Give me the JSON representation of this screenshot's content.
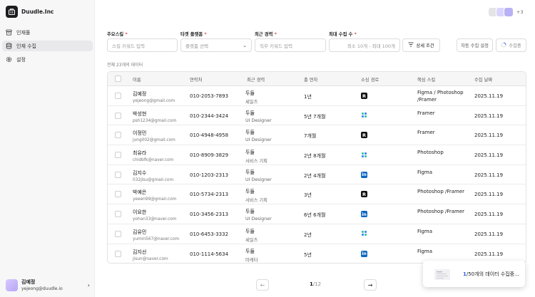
{
  "app": {
    "name": "Duudle.Inc"
  },
  "sidebar": {
    "items": [
      {
        "label": "인재풀",
        "icon": "archive-icon",
        "active": false
      },
      {
        "label": "인재 수집",
        "icon": "database-icon",
        "active": true
      },
      {
        "label": "설정",
        "icon": "gear-icon",
        "active": false
      }
    ]
  },
  "user": {
    "name": "김예정",
    "email": "yejeong@duudle.io"
  },
  "collaborators": {
    "more": "+3",
    "colors": [
      "#e4e4e8",
      "#d8d4fb",
      "#b9b1f5"
    ]
  },
  "filters": {
    "main_skill": {
      "label": "주요스킬",
      "placeholder": "스킬 키워드 입력"
    },
    "target_platform": {
      "label": "타겟 플랫폼",
      "placeholder": "플랫폼 선택"
    },
    "recent_career": {
      "label": "최근 경력",
      "placeholder": "직무 키워드 입력"
    },
    "max_collect": {
      "label": "최대 수집 수",
      "placeholder": "최소 10개 - 최대 100개"
    },
    "detail_button": "상세 조건",
    "auto_setting_button": "자동 수집 설정",
    "collecting_button": "수집중"
  },
  "result_count": "전체 23개의 데이터",
  "table": {
    "headers": [
      "이름",
      "연락처",
      "최근 경력",
      "총 연차",
      "소싱 경로",
      "핵심 스킬",
      "수집 날짜"
    ],
    "rows": [
      {
        "name": "김예정",
        "email": "yejeong@gmail.com",
        "phone": "010-2053-7893",
        "career_company": "두들",
        "career_role": "세일즈",
        "years": "1년",
        "source": "remember",
        "skills": "Figma / Photoshop /Framer",
        "date": "2025.11.19"
      },
      {
        "name": "박성현",
        "email": "psh1234@gmail.com",
        "phone": "010-2344-3424",
        "career_company": "두들",
        "career_role": "UI Designer",
        "years": "5년 7개월",
        "source": "dots",
        "skills": "Framer",
        "date": "2025.11.19"
      },
      {
        "name": "이정민",
        "email": "jung002@gmail.com",
        "phone": "010-4948-4958",
        "career_company": "두들",
        "career_role": "UI Designer",
        "years": "7개월",
        "source": "remember",
        "skills": "Framer",
        "date": "2025.11.19"
      },
      {
        "name": "최유라",
        "email": "chidbfk@naver.com",
        "phone": "010-8909-3829",
        "career_company": "두들",
        "career_role": "서비스 기획",
        "years": "2년 8개월",
        "source": "dots",
        "skills": "Photoshop",
        "date": "2025.11.19"
      },
      {
        "name": "김지수",
        "email": "032jisu@gmail.com",
        "phone": "010-1203-2313",
        "career_company": "두들",
        "career_role": "UI Designer",
        "years": "2년 4개월",
        "source": "linkedin",
        "skills": "Figma",
        "date": "2025.11.19"
      },
      {
        "name": "박예은",
        "email": "yeeen99@gmail.com",
        "phone": "010-5734-2313",
        "career_company": "두들",
        "career_role": "서비스 기획",
        "years": "3년",
        "source": "remember",
        "skills": "Photoshop /Framer",
        "date": "2025.11.19"
      },
      {
        "name": "이요한",
        "email": "yohan33@naver.com",
        "phone": "010-3456-2313",
        "career_company": "두들",
        "career_role": "UI Designer",
        "years": "6년 6개월",
        "source": "linkedin",
        "skills": "Photoshop /Framer",
        "date": "2025.11.19"
      },
      {
        "name": "김유민",
        "email": "yumin567@naver.com",
        "phone": "010-6453-3332",
        "career_company": "두들",
        "career_role": "세일즈",
        "years": "2년",
        "source": "dots",
        "skills": "Figma",
        "date": "2025.11.19"
      },
      {
        "name": "김지선",
        "email": "jisun@naver.com",
        "phone": "010-1114-5634",
        "career_company": "두들",
        "career_role": "마케터",
        "years": "5년",
        "source": "linkedin",
        "skills": "Figma",
        "date": "2025.11.19"
      }
    ]
  },
  "pagination": {
    "current": "1",
    "total": "/12"
  },
  "toast": {
    "progress": "1",
    "text": "/50개의 데이터 수집중..."
  }
}
